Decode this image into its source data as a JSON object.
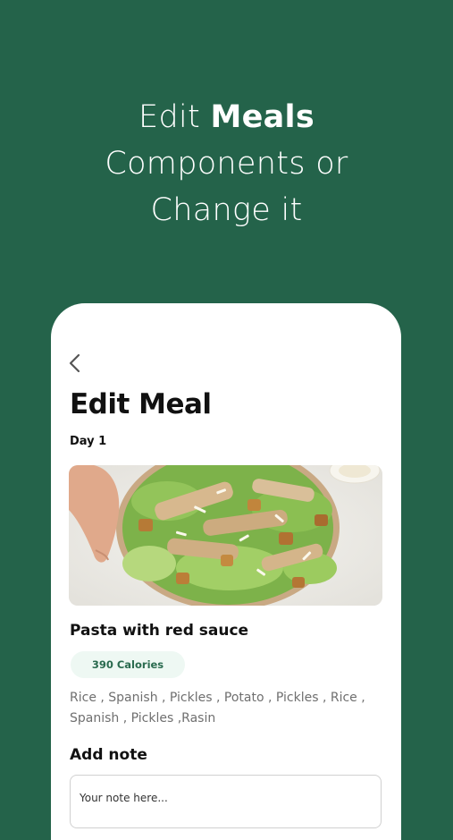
{
  "promo": {
    "line1_prefix": "Edit",
    "line1_bold": "Meals",
    "line2": "Components or",
    "line3": "Change it"
  },
  "screen": {
    "back_icon": "chevron-left-icon",
    "title": "Edit Meal",
    "day": "Day 1",
    "meal_image": "caesar-salad-photo",
    "meal_name": "Pasta with red sauce",
    "calories": "390 Calories",
    "ingredients": "Rice , Spanish , Pickles , Potato , Pickles , Rice , Spanish , Pickles ,Rasin",
    "note_label": "Add note",
    "note_placeholder": "Your note here..."
  },
  "colors": {
    "background": "#24634a",
    "calorie_badge_bg": "#eef8f3",
    "calorie_badge_text": "#2a6b4f"
  }
}
